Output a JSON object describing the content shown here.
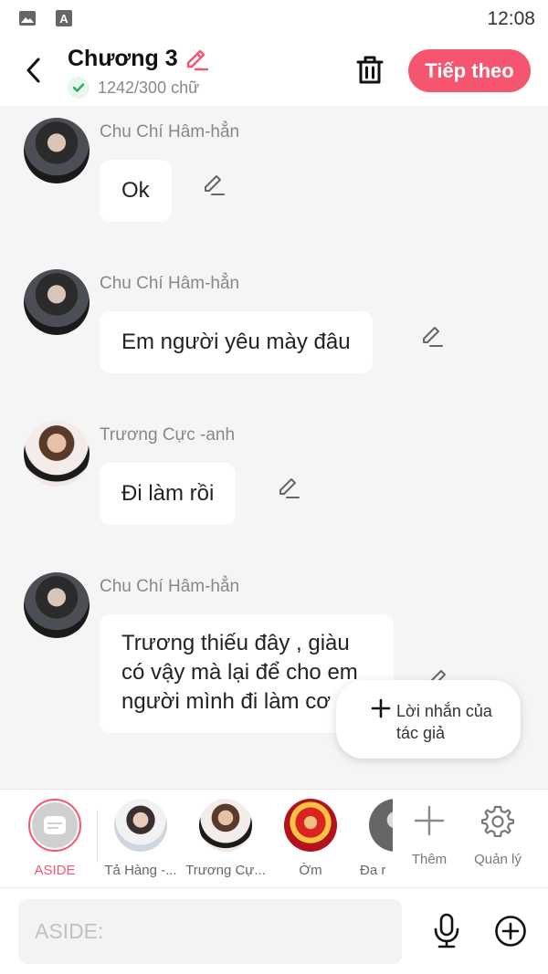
{
  "status_bar": {
    "time": "12:08",
    "icons": [
      "image-icon",
      "font-icon"
    ]
  },
  "header": {
    "back_icon": "chevron-left-icon",
    "title": "Chương 3",
    "edit_icon": "pencil-icon",
    "word_count": "1242/300 chữ",
    "delete_icon": "trash-icon",
    "next_label": "Tiếp theo",
    "colors": {
      "accent": "#f5556f",
      "check": "#27ae60"
    }
  },
  "messages": [
    {
      "sender": "Chu Chí Hâm-hẳn",
      "text": "Ok",
      "avatar": "dark"
    },
    {
      "sender": "Chu Chí Hâm-hẳn",
      "text": "Em người yêu mày đâu",
      "avatar": "dark"
    },
    {
      "sender": "Trương Cực -anh",
      "text": "Đi làm rồi",
      "avatar": "light"
    },
    {
      "sender": "Chu Chí Hâm-hẳn",
      "text": "Trương thiếu đây , giàu có vậy mà lại để cho em người mình đi làm cơ",
      "avatar": "dark"
    }
  ],
  "author_note": {
    "label": "Lời nhắn của tác giả"
  },
  "characters": [
    {
      "name": "ASIDE"
    },
    {
      "name": "Tả Hàng -..."
    },
    {
      "name": "Trương Cự..."
    },
    {
      "name": "Ờm"
    },
    {
      "name": "Đa r"
    }
  ],
  "tools": {
    "add_label": "Thêm",
    "manage_label": "Quản lý"
  },
  "input": {
    "placeholder": "ASIDE:"
  }
}
